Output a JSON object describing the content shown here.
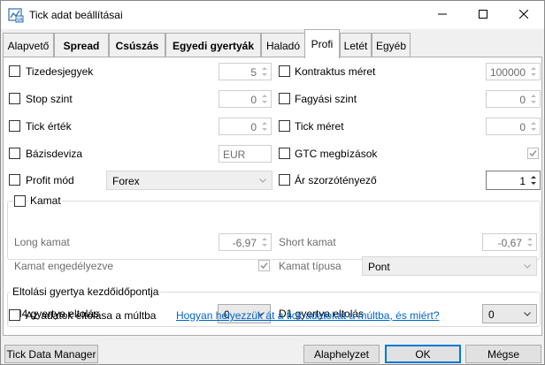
{
  "window": {
    "title": "Tick adat beállításai",
    "icon": "app-icon"
  },
  "tabs": [
    {
      "label": "Alapvető",
      "bold": false,
      "active": false
    },
    {
      "label": "Spread",
      "bold": true,
      "active": false
    },
    {
      "label": "Csúszás",
      "bold": true,
      "active": false
    },
    {
      "label": "Egyedi gyertyák",
      "bold": true,
      "active": false
    },
    {
      "label": "Haladó",
      "bold": false,
      "active": false
    },
    {
      "label": "Profi",
      "bold": false,
      "active": true
    },
    {
      "label": "Letét",
      "bold": false,
      "active": false
    },
    {
      "label": "Egyéb",
      "bold": false,
      "active": false
    }
  ],
  "fields": {
    "decimals": {
      "label": "Tizedesjegyek",
      "value": "5",
      "checked": false
    },
    "contract_size": {
      "label": "Kontraktus méret",
      "value": "100000",
      "checked": false
    },
    "stop_level": {
      "label": "Stop szint",
      "value": "0",
      "checked": false
    },
    "freeze_level": {
      "label": "Fagyási szint",
      "value": "0",
      "checked": false
    },
    "tick_value": {
      "label": "Tick érték",
      "value": "0",
      "checked": false
    },
    "tick_size": {
      "label": "Tick méret",
      "value": "0",
      "checked": false
    },
    "base_currency": {
      "label": "Bázisdeviza",
      "value": "EUR",
      "checked": false
    },
    "gtc_orders": {
      "label": "GTC megbízások",
      "checked": false,
      "value_checked": true
    },
    "profit_mode": {
      "label": "Profit mód",
      "value": "Forex",
      "checked": false
    },
    "price_multiplier": {
      "label": "Ár szorzótényező",
      "value": "1",
      "checked": false
    }
  },
  "swap_group": {
    "title": "Kamat",
    "checked": false,
    "long_label": "Long kamat",
    "long_value": "-6,97",
    "short_label": "Short kamat",
    "short_value": "-0,67",
    "enabled_label": "Kamat engedélyezve",
    "enabled_checked": true,
    "type_label": "Kamat típusa",
    "type_value": "Pont"
  },
  "shift_group": {
    "title": "Eltolási gyertya kezdőidőpontja",
    "h4_label": "H4 gyertya eltolás",
    "h4_value": "0",
    "d1_label": "D1 gyertya eltolás",
    "d1_value": "0"
  },
  "shift_data": {
    "label": "Az adatok eltolása a múltba",
    "checked": false,
    "link": "Hogyan helyezzük át a tick adatokat a múltba, és miért?"
  },
  "footer": {
    "manager_button": "Tick Data Manager",
    "reset_button": "Alaphelyzet",
    "ok_button": "OK",
    "cancel_button": "Mégse"
  },
  "colors": {
    "link": "#0066cc",
    "default_button_border": "#0078d7"
  }
}
